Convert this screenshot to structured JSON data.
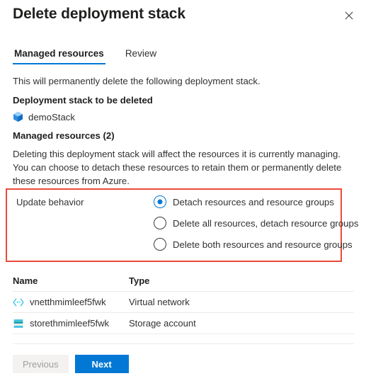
{
  "header": {
    "title": "Delete deployment stack",
    "close_icon": "close-icon"
  },
  "tabs": [
    {
      "label": "Managed resources",
      "active": true
    },
    {
      "label": "Review",
      "active": false
    }
  ],
  "body": {
    "intro": "This will permanently delete the following deployment stack.",
    "stack_section_heading": "Deployment stack to be deleted",
    "stack_name": "demoStack",
    "stack_icon": "deployment-stack-cube-icon",
    "managed_resources_heading": "Managed resources (2)",
    "description": "Deleting this deployment stack will affect the resources it is currently managing. You can choose to detach these resources to retain them or permanently delete these resources from Azure."
  },
  "update_behavior": {
    "label": "Update behavior",
    "highlight_color": "#ec4a3b",
    "accent_color": "#0078d4",
    "options": [
      {
        "label": "Detach resources and resource groups",
        "selected": true
      },
      {
        "label": "Delete all resources, detach resource groups",
        "selected": false
      },
      {
        "label": "Delete both resources and resource groups",
        "selected": false
      }
    ]
  },
  "resources_table": {
    "columns": [
      "Name",
      "Type"
    ],
    "rows": [
      {
        "name": "vnetthmimleef5fwk",
        "type": "Virtual network",
        "icon": "virtual-network-icon"
      },
      {
        "name": "storethmimleef5fwk",
        "type": "Storage account",
        "icon": "storage-account-icon"
      }
    ]
  },
  "footer": {
    "previous_label": "Previous",
    "next_label": "Next",
    "previous_disabled": true
  }
}
